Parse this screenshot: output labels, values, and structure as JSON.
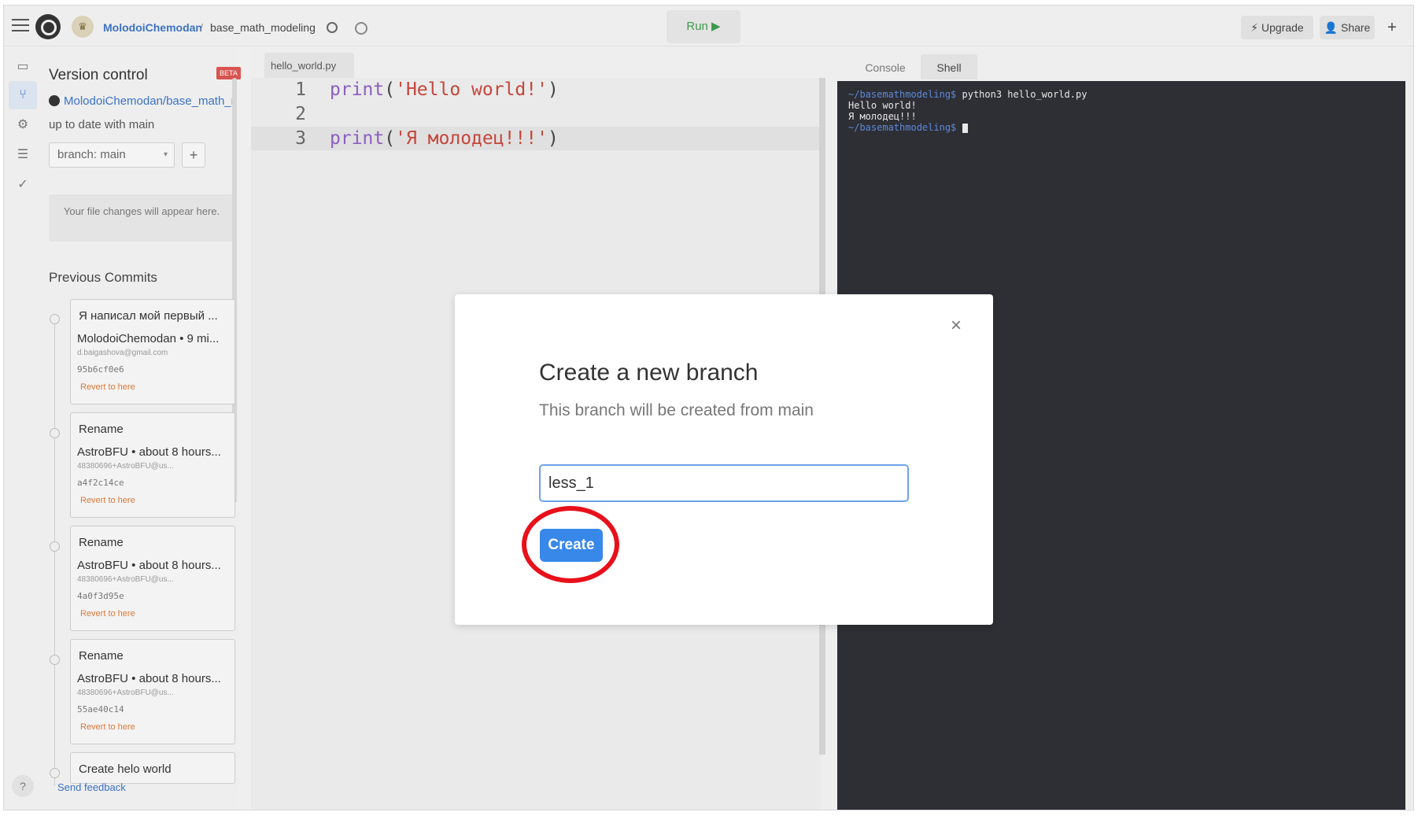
{
  "topbar": {
    "user": "MolodoiChemodan",
    "separator": "/",
    "repl_name": "base_math_modeling",
    "run_label": "Run ▶",
    "upgrade_label": "Upgrade",
    "share_label": "Share",
    "plus_label": "+"
  },
  "version_control": {
    "title": "Version control",
    "beta_badge": "BETA",
    "repo": "MolodoiChemodan/base_math_modeling",
    "status": "up to date with main",
    "branch_select": "branch: main",
    "add_branch_label": "+",
    "changes_placeholder": "Your file changes will appear here.",
    "previous_commits_title": "Previous Commits",
    "commits": [
      {
        "message": "Я написал мой первый ...",
        "author": "MolodoiChemodan • 9 mi...",
        "email": "d.baigashova@gmail.com",
        "hash": "95b6cf0e6",
        "revert": "Revert to here"
      },
      {
        "message": "Rename",
        "author": "AstroBFU • about 8 hours...",
        "email": "48380696+AstroBFU@us...",
        "hash": "a4f2c14ce",
        "revert": "Revert to here"
      },
      {
        "message": "Rename",
        "author": "AstroBFU • about 8 hours...",
        "email": "48380696+AstroBFU@us...",
        "hash": "4a0f3d95e",
        "revert": "Revert to here"
      },
      {
        "message": "Rename",
        "author": "AstroBFU • about 8 hours...",
        "email": "48380696+AstroBFU@us...",
        "hash": "55ae40c14",
        "revert": "Revert to here"
      },
      {
        "message": "Create helo world"
      }
    ],
    "feedback": "Send feedback",
    "help_label": "?"
  },
  "editor": {
    "tab": "hello_world.py",
    "lines": [
      {
        "num": "1",
        "fn": "print",
        "open": "(",
        "str": "'Hello world!'",
        "close": ")"
      },
      {
        "num": "2",
        "fn": "",
        "open": "",
        "str": "",
        "close": ""
      },
      {
        "num": "3",
        "fn": "print",
        "open": "(",
        "str": "'Я молодец!!!'",
        "close": ")"
      }
    ]
  },
  "shell": {
    "tab_console": "Console",
    "tab_shell": "Shell",
    "prompt": "~/basemathmodeling$",
    "command": " python3 hello_world.py",
    "output1": "Hello world!",
    "output2": "Я молодец!!!",
    "prompt2": "~/basemathmodeling$"
  },
  "modal": {
    "close_label": "×",
    "title": "Create a new branch",
    "subtitle": "This branch will be created from main",
    "input_value": "less_1",
    "create_label": "Create"
  },
  "icons": {
    "rail": [
      "file-icon",
      "version-control-icon",
      "settings-icon",
      "database-icon",
      "check-icon"
    ]
  },
  "colors": {
    "accent": "#3888ea",
    "highlight": "#e8101a",
    "run_green": "#3c9a4c",
    "terminal_bg": "#2e2e35"
  }
}
